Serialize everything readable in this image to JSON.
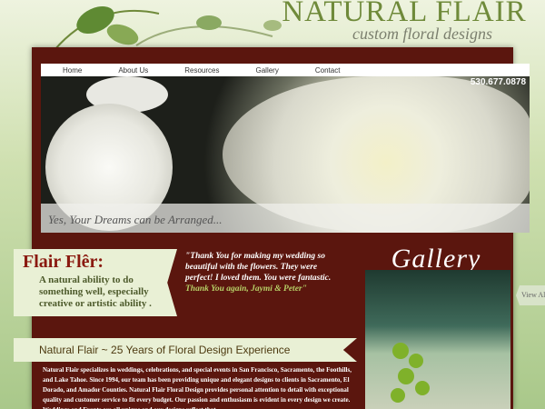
{
  "brand": {
    "title": "NATURAL FLAIR",
    "tagline": "custom floral designs"
  },
  "nav": {
    "items": [
      "Home",
      "About Us",
      "Resources",
      "Gallery",
      "Contact"
    ]
  },
  "hero": {
    "phone": "530.677.0878",
    "caption": "Yes, Your Dreams can be Arranged..."
  },
  "flair": {
    "heading": "Flair Flêr:",
    "definition": "A natural ability to do something well, especially creative or artistic ability ."
  },
  "testimonial": {
    "quote": "\"Thank You for making my wedding so beautiful with the flowers. They were perfect! I loved them. You were fantastic.",
    "signature": "Thank You again, Jaymi & Peter\""
  },
  "gallery": {
    "title": "Gallery",
    "view_all": "View All"
  },
  "section": {
    "heading": "Natural Flair ~ 25 Years of Floral Design Experience"
  },
  "body": {
    "text": "Natural Flair specializes in weddings, celebrations, and special events in San Francisco, Sacramento, the Foothills, and Lake Tahoe. Since 1994, our team has been providing unique and elegant designs to clients in Sacramento, El Dorado, and Amador Counties. Natural Flair Floral Design provides personal attention to detail with exceptional quality and customer service to fit every budget. Our passion and enthusiasm is evident in every design we create. Weddings and Events are all unique and our designs reflect that"
  },
  "colors": {
    "panel": "#5b160e",
    "brand": "#6f8a3a",
    "accent": "#8a1a10"
  }
}
